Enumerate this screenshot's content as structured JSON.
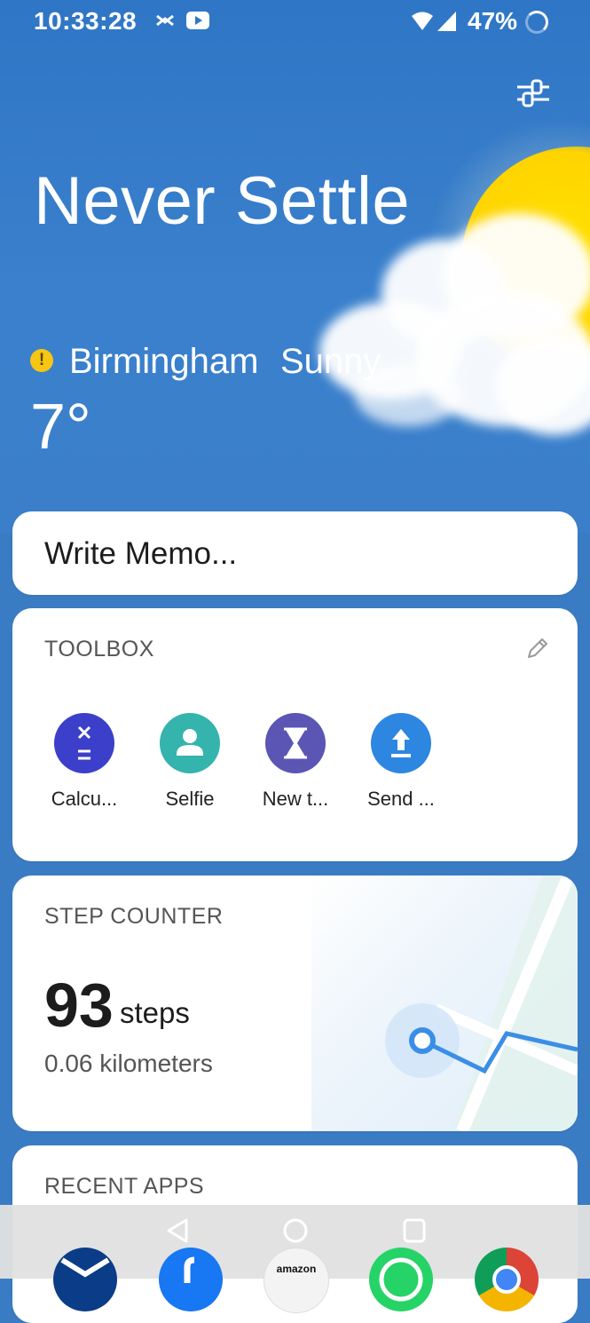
{
  "status_bar": {
    "time": "10:33:28",
    "battery": "47%",
    "icons": [
      "halifax-icon",
      "youtube-icon",
      "wifi-icon",
      "signal-icon",
      "battery-saver-icon"
    ]
  },
  "header": {
    "slogan": "Never Settle",
    "city": "Birmingham",
    "condition": "Sunny",
    "temperature": "7°"
  },
  "memo": {
    "placeholder": "Write Memo..."
  },
  "toolbox": {
    "title": "TOOLBOX",
    "items": [
      {
        "label": "Calcu...",
        "icon": "calculator-icon",
        "color": "#3c3fc9"
      },
      {
        "label": "Selfie",
        "icon": "person-icon",
        "color": "#35b3ad"
      },
      {
        "label": "New t...",
        "icon": "hourglass-icon",
        "color": "#5b55b4"
      },
      {
        "label": "Send ...",
        "icon": "upload-icon",
        "color": "#2d86e0"
      }
    ]
  },
  "step_counter": {
    "title": "STEP COUNTER",
    "steps": "93",
    "unit": "steps",
    "distance": "0.06 kilometers"
  },
  "recent_apps": {
    "title": "RECENT APPS"
  },
  "dock": {
    "apps": [
      {
        "name": "halifax-app-icon",
        "color": "#0a3c87"
      },
      {
        "name": "facebook-app-icon",
        "color": "#1877f2"
      },
      {
        "name": "amazon-app-icon",
        "label": "amazon",
        "color": "#f3f3f3"
      },
      {
        "name": "whatsapp-app-icon",
        "color": "#25d366"
      },
      {
        "name": "chrome-app-icon",
        "color": "#db4437"
      }
    ]
  },
  "colors": {
    "sky": "#2f76c6",
    "sun": "#ffd400",
    "warning": "#f7c514"
  }
}
